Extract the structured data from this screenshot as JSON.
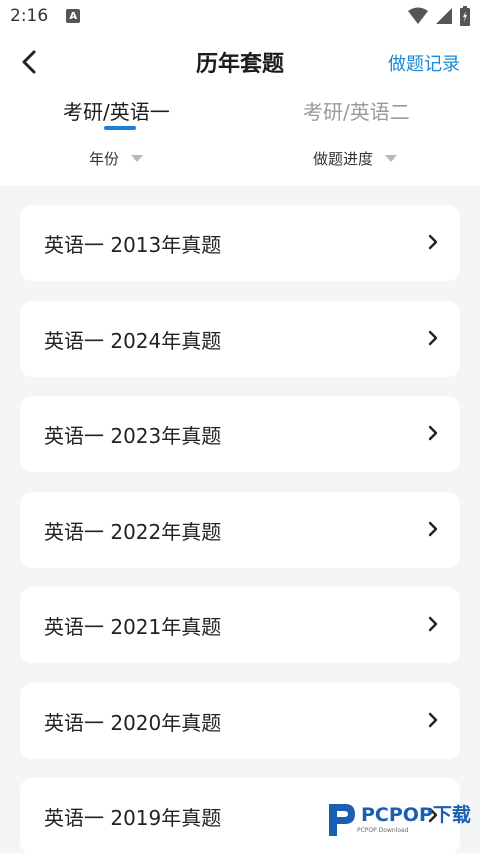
{
  "status_bar": {
    "time": "2:16",
    "notification_icon": "A"
  },
  "header": {
    "title": "历年套题",
    "history_link": "做题记录"
  },
  "tabs": [
    {
      "label": "考研/英语一",
      "active": true
    },
    {
      "label": "考研/英语二",
      "active": false
    }
  ],
  "filters": {
    "year": "年份",
    "progress": "做题进度"
  },
  "list": [
    {
      "label": "英语一 2013年真题"
    },
    {
      "label": "英语一 2024年真题"
    },
    {
      "label": "英语一 2023年真题"
    },
    {
      "label": "英语一 2022年真题"
    },
    {
      "label": "英语一 2021年真题"
    },
    {
      "label": "英语一 2020年真题"
    },
    {
      "label": "英语一 2019年真题"
    }
  ],
  "watermark": {
    "brand": "PCPOP下载",
    "sub": "PCPOP Download"
  },
  "colors": {
    "accent": "#1a8ad6",
    "tab_indicator": "#1a7fe0",
    "list_background": "#f4f5f7"
  }
}
